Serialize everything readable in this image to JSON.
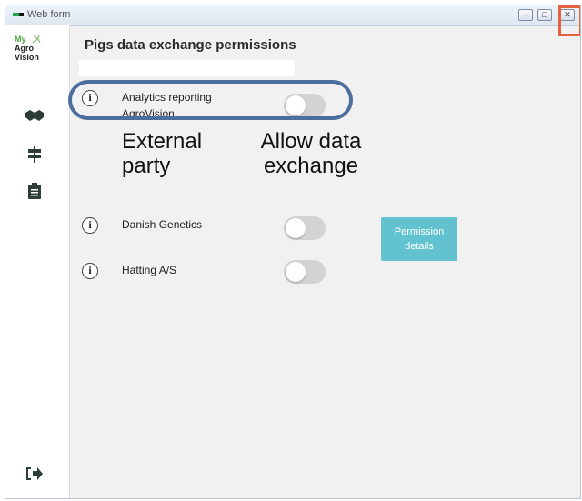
{
  "window": {
    "title": "Web form"
  },
  "sidebar": {
    "logo": {
      "line1": "My",
      "line2": "Agro",
      "line3": "Vision"
    },
    "items": [
      {
        "icon": "handshake-icon",
        "glyph": "🤝"
      },
      {
        "icon": "signpost-icon",
        "glyph": "≡"
      },
      {
        "icon": "clipboard-icon",
        "glyph": "📋"
      }
    ],
    "logout_icon": "logout-icon",
    "logout_glyph": "➡"
  },
  "main": {
    "title": "Pigs data exchange permissions",
    "columns": {
      "party": "External party",
      "allow": "Allow data exchange"
    },
    "parties": [
      {
        "name_line1": "Analytics reporting",
        "name_line2": "AgroVision",
        "allowed": false
      },
      {
        "name_line1": "Danish Genetics",
        "name_line2": "",
        "allowed": false
      },
      {
        "name_line1": "Hatting A/S",
        "name_line2": "",
        "allowed": false
      }
    ],
    "permission_button": {
      "line1": "Permission",
      "line2": "details"
    },
    "info_glyph": "i"
  },
  "colors": {
    "accent_button": "#62c2cf",
    "highlight_outline": "#4b6e9e",
    "close_highlight": "#e4623f"
  }
}
